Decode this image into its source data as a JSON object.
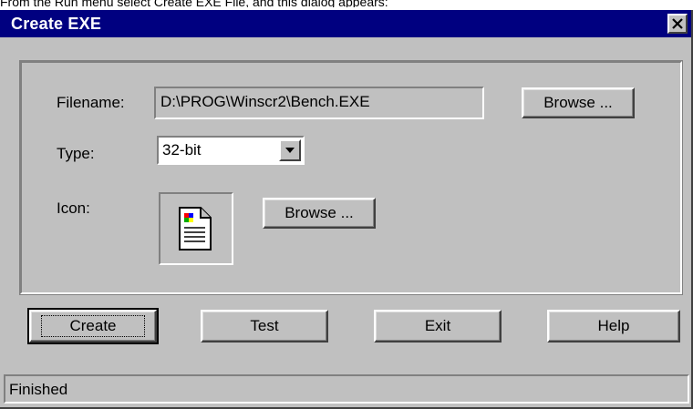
{
  "caption": "From the Run menu select Create EXE File, and this dialog appears:",
  "window": {
    "title": "Create EXE"
  },
  "form": {
    "filename_label": "Filename:",
    "filename_value": "D:\\PROG\\Winscr2\\Bench.EXE",
    "browse_label": "Browse ...",
    "type_label": "Type:",
    "type_value": "32-bit",
    "icon_label": "Icon:",
    "icon_browse_label": "Browse ..."
  },
  "buttons": {
    "create": "Create",
    "test": "Test",
    "exit": "Exit",
    "help": "Help"
  },
  "status": {
    "text": "Finished"
  },
  "colors": {
    "titlebar": "#000080",
    "face": "#c0c0c0"
  },
  "icons": {
    "close": "close-icon",
    "dropdown": "chevron-down-icon",
    "file": "document-icon"
  }
}
